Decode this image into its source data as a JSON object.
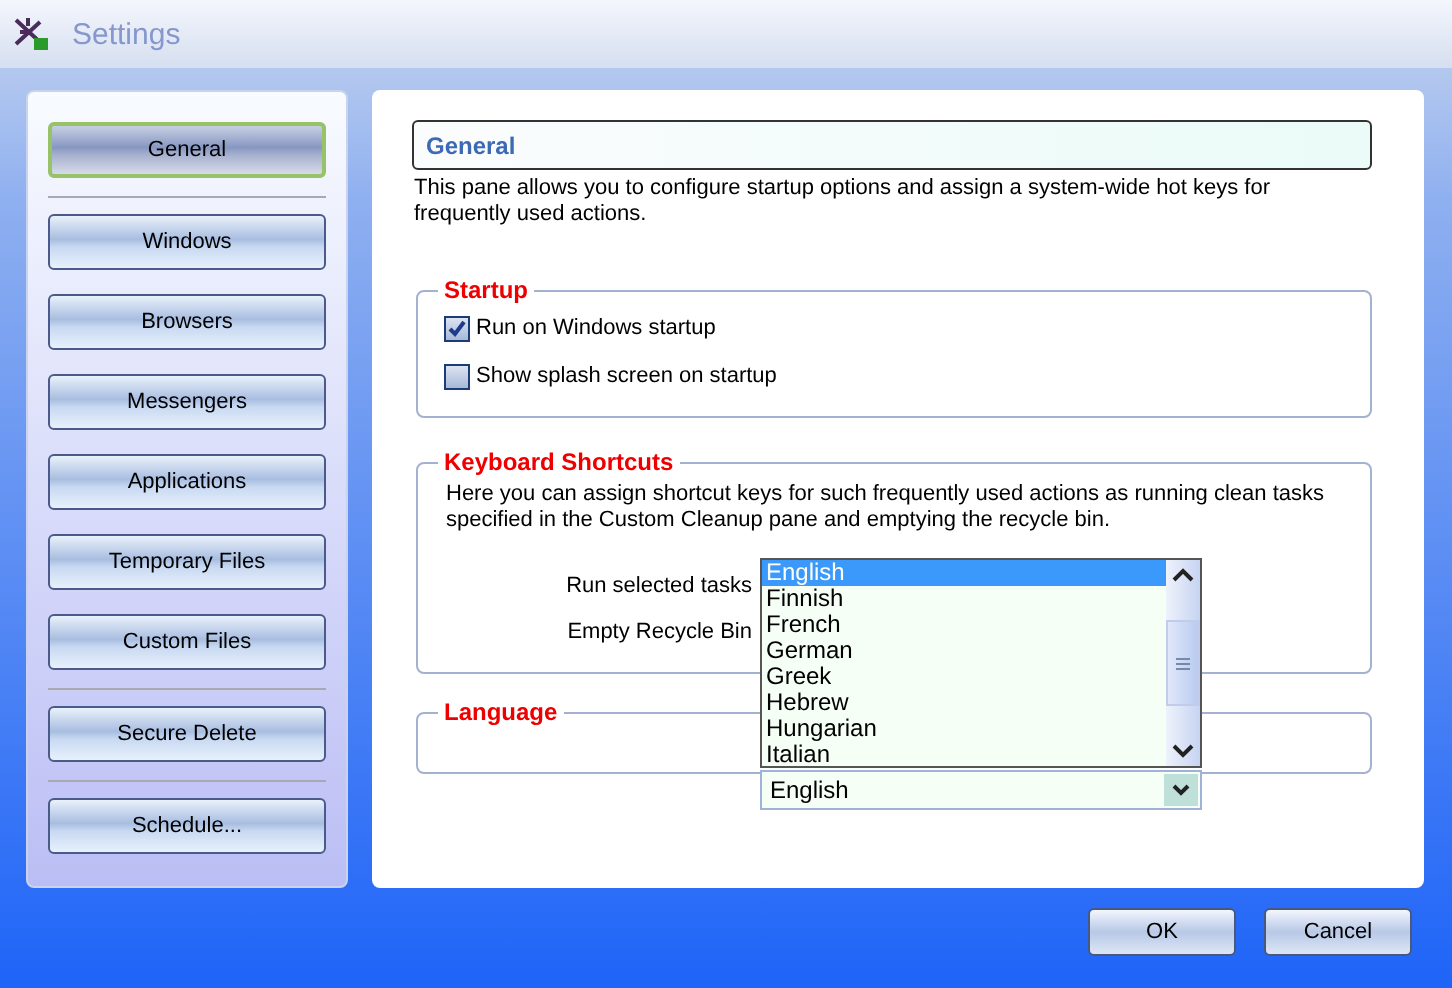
{
  "window": {
    "title": "Settings"
  },
  "sidebar": {
    "groups": [
      [
        {
          "label": "General",
          "selected": true
        }
      ],
      [
        {
          "label": "Windows",
          "selected": false
        },
        {
          "label": "Browsers",
          "selected": false
        },
        {
          "label": "Messengers",
          "selected": false
        },
        {
          "label": "Applications",
          "selected": false
        },
        {
          "label": "Temporary Files",
          "selected": false
        },
        {
          "label": "Custom Files",
          "selected": false
        }
      ],
      [
        {
          "label": "Secure Delete",
          "selected": false
        }
      ],
      [
        {
          "label": "Schedule...",
          "selected": false
        }
      ]
    ]
  },
  "pane": {
    "title": "General",
    "description": "This pane allows you to configure startup options and assign a system-wide hot keys for frequently used actions.",
    "startup": {
      "title": "Startup",
      "options": [
        {
          "label": "Run on Windows startup",
          "checked": true
        },
        {
          "label": "Show splash screen on startup",
          "checked": false
        }
      ]
    },
    "shortcuts": {
      "title": "Keyboard Shortcuts",
      "description": "Here you can assign shortcut keys for such frequently used actions as running clean tasks specified in the Custom Cleanup pane and emptying the recycle bin.",
      "rows": [
        {
          "label": "Run selected tasks"
        },
        {
          "label": "Empty Recycle Bin"
        }
      ]
    },
    "language": {
      "title": "Language",
      "value": "English",
      "options": [
        {
          "label": "English",
          "selected": true
        },
        {
          "label": "Finnish",
          "selected": false
        },
        {
          "label": "French",
          "selected": false
        },
        {
          "label": "German",
          "selected": false
        },
        {
          "label": "Greek",
          "selected": false
        },
        {
          "label": "Hebrew",
          "selected": false
        },
        {
          "label": "Hungarian",
          "selected": false
        },
        {
          "label": "Italian",
          "selected": false
        }
      ]
    }
  },
  "buttons": [
    "OK",
    "Cancel"
  ]
}
